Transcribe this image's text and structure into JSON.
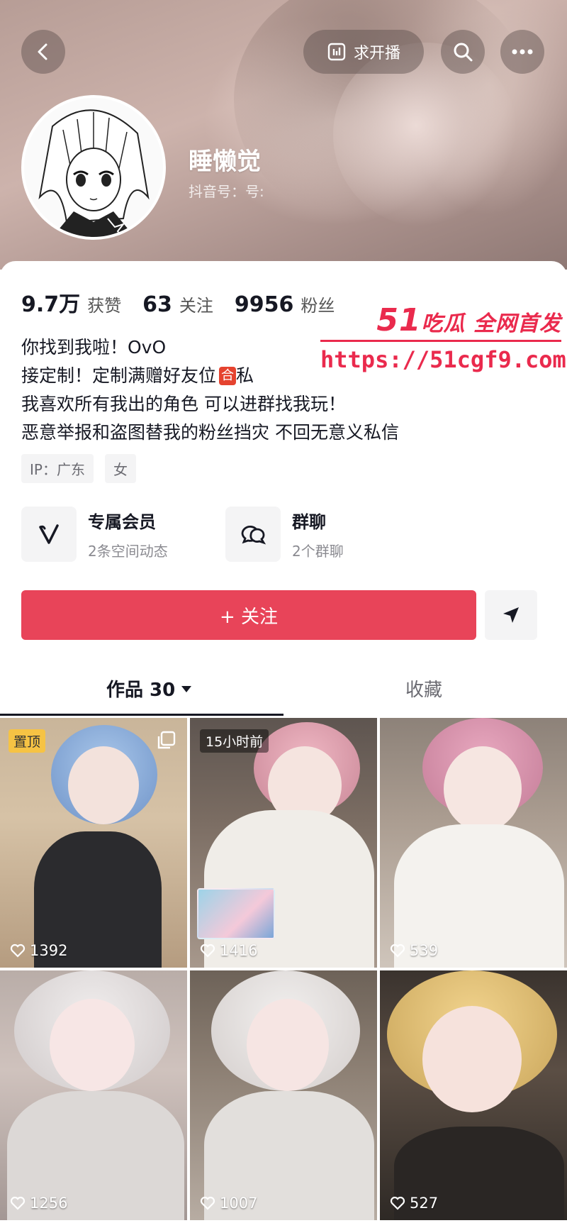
{
  "header": {
    "live_request_label": "求开播",
    "nickname": "睡懒觉",
    "douyin_id": "抖音号：号:"
  },
  "stats": [
    {
      "value": "9.7万",
      "label": "获赞"
    },
    {
      "value": "63",
      "label": "关注"
    },
    {
      "value": "9956",
      "label": "粉丝"
    }
  ],
  "bio": {
    "line1": "你找到我啦！OvO",
    "line2_prefix": "接定制！定制满赠好友位",
    "line2_badge": "合",
    "line2_suffix": "私",
    "line3": "我喜欢所有我出的角色 可以进群找我玩！",
    "line4": "恶意举报和盗图替我的粉丝挡灾 不回无意义私信"
  },
  "watermark": {
    "brand_number": "51",
    "brand_text": "吃瓜 全网首发",
    "url": "https://51cgf9.com"
  },
  "tags": [
    "IP：广东",
    "女"
  ],
  "features": [
    {
      "title": "专属会员",
      "subtitle": "2条空间动态",
      "icon": "v-badge-icon"
    },
    {
      "title": "群聊",
      "subtitle": "2个群聊",
      "icon": "chat-bubbles-icon"
    }
  ],
  "actions": {
    "follow_label": "+ 关注"
  },
  "tabs": {
    "works_label": "作品 30",
    "favorites_label": "收藏"
  },
  "videos": [
    {
      "likes": "1392",
      "badge": "置顶"
    },
    {
      "likes": "1416",
      "badge": "15小时前"
    },
    {
      "likes": "539"
    },
    {
      "likes": "1256"
    },
    {
      "likes": "1007"
    },
    {
      "likes": "527"
    }
  ],
  "colors": {
    "accent": "#e84459",
    "watermark": "#ea2a4d",
    "pin_badge": "#f6c344"
  }
}
